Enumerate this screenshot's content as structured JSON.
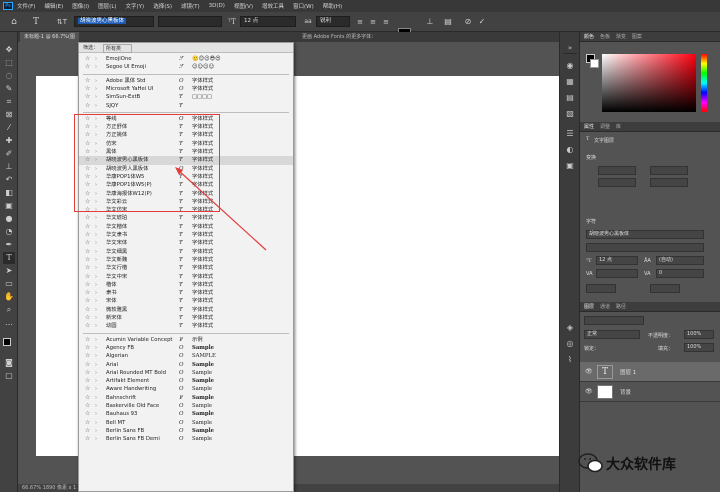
{
  "menubar": {
    "logo": "Ps",
    "items": [
      "文件(F)",
      "编辑(E)",
      "图像(I)",
      "图层(L)",
      "文字(Y)",
      "选择(S)",
      "滤镜(T)",
      "3D(D)",
      "视图(V)",
      "增效工具",
      "窗口(W)",
      "帮助(H)"
    ]
  },
  "options": {
    "font_family": "胡晓波男心黑板体",
    "font_size": "12 点",
    "antialias": "锐利",
    "color": "#000000"
  },
  "tab": {
    "title": "未标题-1 @ 66.7%(图",
    "filter_label": "筛选：",
    "filter_value": "所有类",
    "adobe_fonts_hint": "更画 Adobe Fonts 的更多字体："
  },
  "status": "66.67%  1890 像素 x 1",
  "fontlist": {
    "groups": [
      [
        {
          "name": "EmojiOne",
          "type": "svg",
          "sample": "🙂😊😉😎😍"
        },
        {
          "name": "Segoe UI Emoji",
          "type": "svg",
          "sample": "☺☺☺☺"
        }
      ],
      [
        {
          "name": "Adobe 黑体 Std",
          "type": "O",
          "sample": "字体样式"
        },
        {
          "name": "Microsoft YaHei UI",
          "type": "O",
          "sample": "字体样式"
        },
        {
          "name": "SimSun-ExtB",
          "type": "Tt",
          "sample": "□□□□"
        },
        {
          "name": "SJQY",
          "type": "Tt",
          "sample": ""
        }
      ],
      [
        {
          "name": "等线",
          "type": "O",
          "sample": "字体样式"
        },
        {
          "name": "方正舒体",
          "type": "Tt",
          "sample": "字体样式"
        },
        {
          "name": "方正姚体",
          "type": "Tt",
          "sample": "字体样式"
        },
        {
          "name": "仿宋",
          "type": "Tt",
          "sample": "字体样式"
        },
        {
          "name": "黑体",
          "type": "Tt",
          "sample": "字体样式"
        },
        {
          "name": "胡晓波男心黑板体",
          "type": "Tt",
          "sample": "字体样式",
          "highlight": true
        },
        {
          "name": "胡晓波男人黑板体",
          "type": "O",
          "sample": "字体样式"
        },
        {
          "name": "华康POP1体W5",
          "type": "Tt",
          "sample": "字体样式"
        },
        {
          "name": "华康POP1体W5(P)",
          "type": "Tt",
          "sample": "字体样式"
        },
        {
          "name": "华康海报体W12(P)",
          "type": "Tt",
          "sample": "字体样式"
        },
        {
          "name": "华文彩云",
          "type": "Tt",
          "sample": "字体样式"
        },
        {
          "name": "华文仿宋",
          "type": "Tt",
          "sample": "字体样式"
        },
        {
          "name": "华文琥珀",
          "type": "Tt",
          "sample": "字体样式"
        },
        {
          "name": "华文楷体",
          "type": "Tt",
          "sample": "字体样式"
        },
        {
          "name": "华文隶书",
          "type": "Tt",
          "sample": "字体样式"
        },
        {
          "name": "华文宋体",
          "type": "Tt",
          "sample": "字体样式"
        },
        {
          "name": "华文细黑",
          "type": "Tt",
          "sample": "字体样式"
        },
        {
          "name": "华文新魏",
          "type": "Tt",
          "sample": "字体样式"
        },
        {
          "name": "华文行楷",
          "type": "Tt",
          "sample": "字体样式"
        },
        {
          "name": "华文中宋",
          "type": "Tt",
          "sample": "字体样式"
        },
        {
          "name": "楷体",
          "type": "Tt",
          "sample": "字体样式"
        },
        {
          "name": "隶书",
          "type": "Tt",
          "sample": "字体样式"
        },
        {
          "name": "宋体",
          "type": "Tt",
          "sample": "字体样式"
        },
        {
          "name": "微软雅黑",
          "type": "Tt",
          "sample": "字体样式"
        },
        {
          "name": "新宋体",
          "type": "Tt",
          "sample": "字体样式"
        },
        {
          "name": "幼圆",
          "type": "Tt",
          "sample": "字体样式"
        }
      ],
      [
        {
          "name": "Acumin Variable Concept",
          "type": "var",
          "sample": "示例"
        },
        {
          "name": "Agency FB",
          "type": "O",
          "sample": "Sample"
        },
        {
          "name": "Algerian",
          "type": "O",
          "sample": "SAMPLE"
        },
        {
          "name": "Arial",
          "type": "O",
          "sample": "Sample"
        },
        {
          "name": "Arial Rounded MT Bold",
          "type": "O",
          "sample": "Sample"
        },
        {
          "name": "Artifakt Element",
          "type": "O",
          "sample": "Sample"
        },
        {
          "name": "Aware Handwriting",
          "type": "O",
          "sample": "Sample"
        },
        {
          "name": "Bahnschrift",
          "type": "var",
          "sample": "Sample"
        },
        {
          "name": "Baskerville Old Face",
          "type": "O",
          "sample": "Sample"
        },
        {
          "name": "Bauhaus 93",
          "type": "O",
          "sample": "Sample"
        },
        {
          "name": "Bell MT",
          "type": "O",
          "sample": "Sample"
        },
        {
          "name": "Berlin Sans FB",
          "type": "O",
          "sample": "Sample"
        },
        {
          "name": "Berlin Sans FB Demi",
          "type": "O",
          "sample": "Sample"
        }
      ]
    ]
  },
  "panels": {
    "color_tabs": [
      "颜色",
      "色板",
      "渐变",
      "图案"
    ],
    "props_tabs": [
      "属性",
      "调整",
      "库"
    ],
    "props_sub": "文字图层",
    "transform_label": "变换",
    "char_label": "字符",
    "char_font": "胡晓波男心黑板体",
    "char_size": "12 点",
    "char_leading": "(自动)",
    "char_tracking": "0",
    "layers_tabs": [
      "图层",
      "通道",
      "路径"
    ],
    "blend": "正常",
    "opacity_label": "不透明度：",
    "opacity": "100%",
    "fill_label": "填充：",
    "fill": "100%",
    "lock_label": "锁定：",
    "layers": [
      {
        "name": "图层 1",
        "kind": "text",
        "thumb": "T"
      },
      {
        "name": "背景",
        "kind": "bg",
        "thumb": ""
      }
    ]
  },
  "strip": [
    "颜色",
    "色板",
    "渐变",
    "图案",
    "属性",
    "调整",
    "库"
  ],
  "watermark": "大众软件库",
  "colors": {
    "accent": "#1b5bb5",
    "annotation": "#e43b3b",
    "menu_bg": "#383838",
    "panel_bg": "#535353"
  }
}
